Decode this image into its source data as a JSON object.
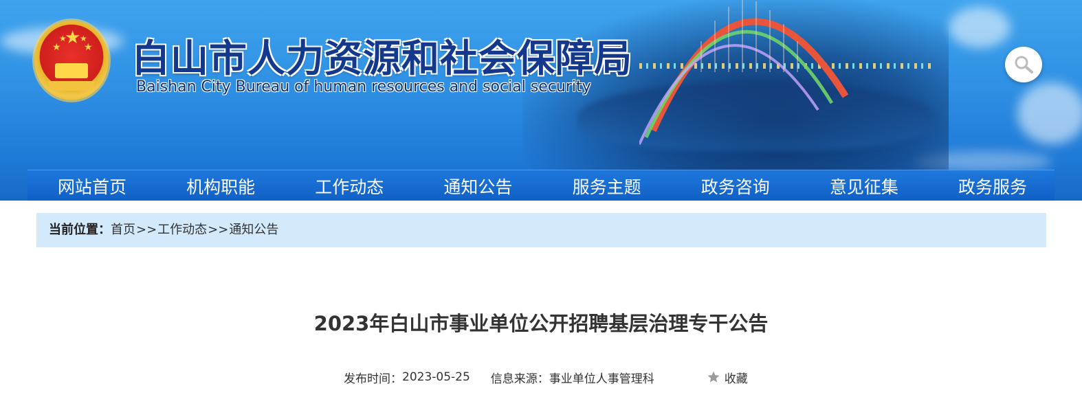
{
  "header": {
    "title_cn": "白山市人力资源和社会保障局",
    "title_en": "Baishan City Bureau of human resources and social security",
    "search_icon": "search-icon",
    "emblem_icon": "national-emblem"
  },
  "nav": {
    "items": [
      {
        "label": "网站首页"
      },
      {
        "label": "机构职能"
      },
      {
        "label": "工作动态"
      },
      {
        "label": "通知公告"
      },
      {
        "label": "服务主题"
      },
      {
        "label": "政务咨询"
      },
      {
        "label": "意见征集"
      },
      {
        "label": "政务服务"
      }
    ]
  },
  "breadcrumb": {
    "label": "当前位置：",
    "items": [
      "首页",
      "工作动态",
      "通知公告"
    ],
    "separator": ">>"
  },
  "article": {
    "title": "2023年白山市事业单位公开招聘基层治理专干公告",
    "publish_label": "发布时间：",
    "publish_date": "2023-05-25",
    "source_label": "信息来源：",
    "source": "事业单位人事管理科",
    "favorite_label": "收藏"
  },
  "colors": {
    "nav_bg": "#1068c8",
    "breadcrumb_bg": "#d2eafc",
    "title_cn": "#13388c"
  }
}
